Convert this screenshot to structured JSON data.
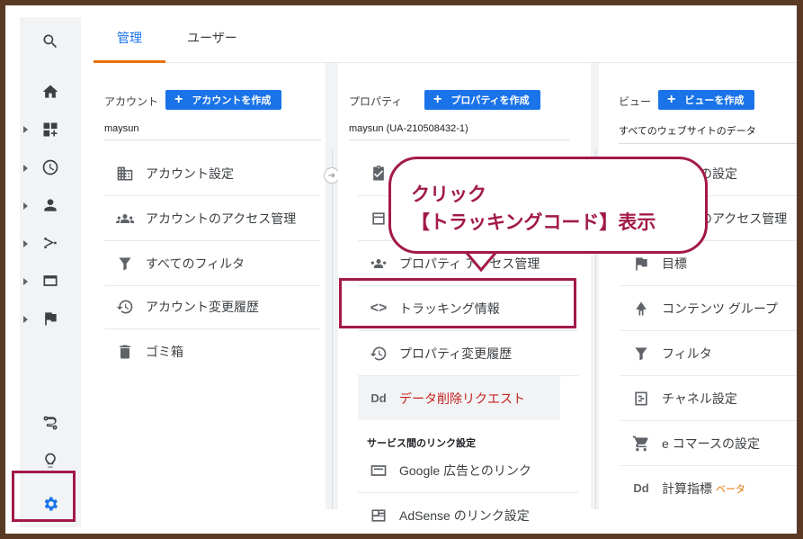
{
  "nav": {
    "icons": [
      "search-icon",
      "home-icon",
      "dashboard-icon",
      "clock-icon",
      "person-icon",
      "acquisition-icon",
      "behavior-icon",
      "flag-icon",
      "route-icon",
      "lightbulb-icon",
      "gear-icon"
    ]
  },
  "tabs": [
    {
      "label": "管理"
    },
    {
      "label": "ユーザー"
    }
  ],
  "account": {
    "header": "アカウント",
    "create_label": "アカウントを作成",
    "selected": "maysun",
    "items": [
      {
        "label": "アカウント設定",
        "icon": "building-icon"
      },
      {
        "label": "アカウントのアクセス管理",
        "icon": "people-icon"
      },
      {
        "label": "すべてのフィルタ",
        "icon": "filter-icon"
      },
      {
        "label": "アカウント変更履歴",
        "icon": "history-icon"
      },
      {
        "label": "ゴミ箱",
        "icon": "trash-icon"
      }
    ]
  },
  "property": {
    "header": "プロパティ",
    "create_label": "プロパティを作成",
    "selected": "maysun (UA-210508432-1)",
    "items": [
      {
        "label": "プロパティ アクセス管理",
        "icon": "people-icon"
      },
      {
        "label": "トラッキング情報",
        "icon": "code-icon"
      },
      {
        "label": "プロパティ変更履歴",
        "icon": "history-icon"
      },
      {
        "label": "データ削除リクエスト",
        "icon": "dd-icon"
      }
    ],
    "link_section": "サービス間のリンク設定",
    "links": [
      {
        "label": "Google 広告とのリンク",
        "icon": "ads-icon"
      },
      {
        "label": "AdSense のリンク設定",
        "icon": "adsense-icon"
      }
    ]
  },
  "view": {
    "header": "ビュー",
    "create_label": "ビューを作成",
    "selected": "すべてのウェブサイトのデータ",
    "items": [
      {
        "label": "ビューの設定",
        "icon": "doc-icon"
      },
      {
        "label": "ビューのアクセス管理",
        "icon": "people-icon"
      },
      {
        "label": "目標",
        "icon": "flag-icon"
      },
      {
        "label": "コンテンツ グループ",
        "icon": "content-group-icon"
      },
      {
        "label": "フィルタ",
        "icon": "filter-icon"
      },
      {
        "label": "チャネル設定",
        "icon": "channel-icon"
      },
      {
        "label": "e コマースの設定",
        "icon": "cart-icon"
      },
      {
        "label": "計算指標",
        "icon": "dd-icon",
        "badge": "ベータ"
      }
    ]
  },
  "callout": {
    "line1": "クリック",
    "line2": "【トラッキングコード】表示"
  },
  "colors": {
    "accent": "#1a73e8",
    "annotation": "#a2194a",
    "tab_underline": "#e8710a"
  }
}
